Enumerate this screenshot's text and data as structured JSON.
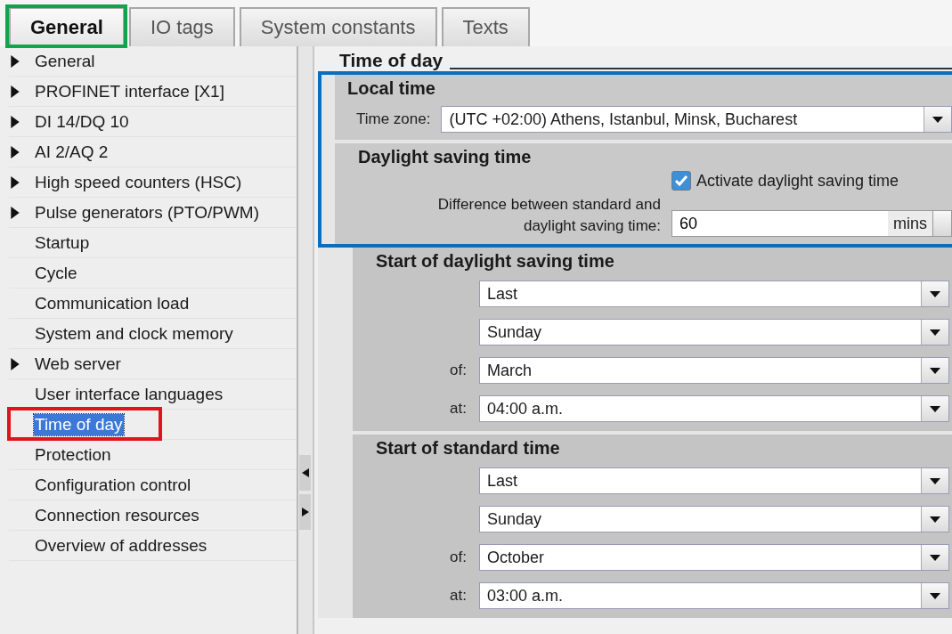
{
  "tabs": [
    {
      "label": "General",
      "selected": true,
      "highlighted": true
    },
    {
      "label": "IO tags",
      "selected": false,
      "highlighted": false
    },
    {
      "label": "System constants",
      "selected": false,
      "highlighted": false
    },
    {
      "label": "Texts",
      "selected": false,
      "highlighted": false
    }
  ],
  "sidebar": {
    "items": [
      {
        "label": "General",
        "expandable": true,
        "selected": false,
        "highlighted": false
      },
      {
        "label": "PROFINET interface [X1]",
        "expandable": true,
        "selected": false,
        "highlighted": false
      },
      {
        "label": "DI 14/DQ 10",
        "expandable": true,
        "selected": false,
        "highlighted": false
      },
      {
        "label": "AI 2/AQ 2",
        "expandable": true,
        "selected": false,
        "highlighted": false
      },
      {
        "label": "High speed counters (HSC)",
        "expandable": true,
        "selected": false,
        "highlighted": false
      },
      {
        "label": "Pulse generators (PTO/PWM)",
        "expandable": true,
        "selected": false,
        "highlighted": false
      },
      {
        "label": "Startup",
        "expandable": false,
        "selected": false,
        "highlighted": false
      },
      {
        "label": "Cycle",
        "expandable": false,
        "selected": false,
        "highlighted": false
      },
      {
        "label": "Communication load",
        "expandable": false,
        "selected": false,
        "highlighted": false
      },
      {
        "label": "System and clock memory",
        "expandable": false,
        "selected": false,
        "highlighted": false
      },
      {
        "label": "Web server",
        "expandable": true,
        "selected": false,
        "highlighted": false
      },
      {
        "label": "User interface languages",
        "expandable": false,
        "selected": false,
        "highlighted": false
      },
      {
        "label": "Time of day",
        "expandable": false,
        "selected": true,
        "highlighted": true
      },
      {
        "label": "Protection",
        "expandable": false,
        "selected": false,
        "highlighted": false
      },
      {
        "label": "Configuration control",
        "expandable": false,
        "selected": false,
        "highlighted": false
      },
      {
        "label": "Connection resources",
        "expandable": false,
        "selected": false,
        "highlighted": false
      },
      {
        "label": "Overview of addresses",
        "expandable": false,
        "selected": false,
        "highlighted": false
      }
    ]
  },
  "panel": {
    "title": "Time of day",
    "highlighted": true,
    "local_time": {
      "title": "Local time",
      "time_zone": {
        "label": "Time zone:",
        "value": "(UTC +02:00) Athens, Istanbul, Minsk, Bucharest"
      }
    },
    "daylight_saving": {
      "title": "Daylight saving time",
      "activate": {
        "label": "Activate daylight saving time",
        "checked": true
      },
      "difference": {
        "label": "Difference between standard and daylight saving time:",
        "value": "60",
        "unit": "mins"
      }
    },
    "schedules": [
      {
        "title": "Start of daylight saving time",
        "fields": [
          {
            "value": "Last"
          },
          {
            "value": "Sunday"
          },
          {
            "label": "of:",
            "value": "March"
          },
          {
            "label": "at:",
            "value": "04:00 a.m."
          }
        ]
      },
      {
        "title": "Start of standard time",
        "fields": [
          {
            "value": "Last"
          },
          {
            "value": "Sunday"
          },
          {
            "label": "of:",
            "value": "October"
          },
          {
            "label": "at:",
            "value": "03:00 a.m."
          }
        ]
      }
    ]
  }
}
